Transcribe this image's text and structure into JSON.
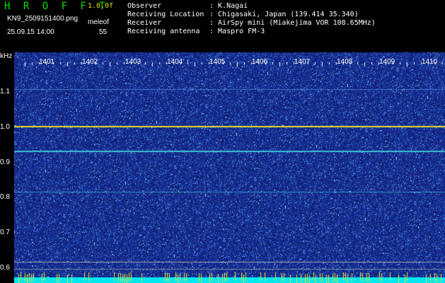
{
  "header": {
    "brand": "H R O F F T",
    "version": "1.0.0f",
    "filename": "KN9_2509151400.png",
    "meleo_label": "meleof",
    "datetime": "25.09.15 14:00",
    "meleo_value": "55",
    "info": [
      {
        "label": "Observer",
        "value": ": K.Nagai"
      },
      {
        "label": "Receiving Location",
        "value": ": Chigasaki, Japan (139.414 35.340)"
      },
      {
        "label": "Receiver",
        "value": ": AirSpy mini (Miakejima VOR 108.65MHz)"
      },
      {
        "label": "Receiving antenna",
        "value": ": Maspro FM-3"
      }
    ]
  },
  "axes": {
    "y_unit": "kHz",
    "y_ticks": [
      "1.1",
      "1.0",
      "0.9",
      "0.8",
      "0.7",
      "0.6"
    ],
    "x_ticks": [
      "1401",
      "1402",
      "1403",
      "1404",
      "1405",
      "1406",
      "1407",
      "1408",
      "1409",
      "1410"
    ]
  },
  "colors": {
    "background": "#1a2a8a",
    "noise_light": "#6ab8ff",
    "line_yellow": "#e8e030",
    "line_cyan": "#40d0e0",
    "bottom_band": "#00e8f0"
  }
}
